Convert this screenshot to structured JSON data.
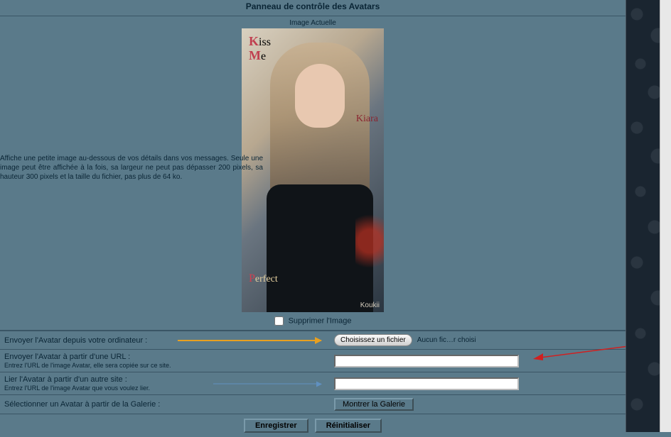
{
  "panel": {
    "title": "Panneau de contrôle des Avatars",
    "current_image_label": "Image Actuelle",
    "delete_label": "Supprimer l'Image",
    "help_text": "Affiche une petite image au-dessous de vos détails dans vos messages. Seule une image peut être affichée à la fois, sa largeur ne peut pas dépasser 200 pixels, sa hauteur 300 pixels et la taille du fichier, pas plus de 64 ko."
  },
  "avatar": {
    "text_kiss": "Kiss",
    "text_me": "Me",
    "text_kiara": "Kiara",
    "text_perfect": "Perfect",
    "text_koukii": "Koukii"
  },
  "rows": {
    "upload_pc": {
      "label": "Envoyer l'Avatar depuis votre ordinateur :",
      "button": "Choisissez un fichier",
      "status": "Aucun fic…r choisi"
    },
    "upload_url": {
      "label": "Envoyer l'Avatar à partir d'une URL :",
      "sub": "Entrez l'URL de l'image Avatar, elle sera copiée sur ce site."
    },
    "link_site": {
      "label": "Lier l'Avatar à partir d'un autre site :",
      "sub": "Entrez l'URL de l'image Avatar que vous voulez lier."
    },
    "gallery": {
      "label": "Sélectionner un Avatar à partir de la Galerie :",
      "button": "Montrer la Galerie"
    }
  },
  "buttons": {
    "save": "Enregistrer",
    "reset": "Réinitialiser"
  }
}
